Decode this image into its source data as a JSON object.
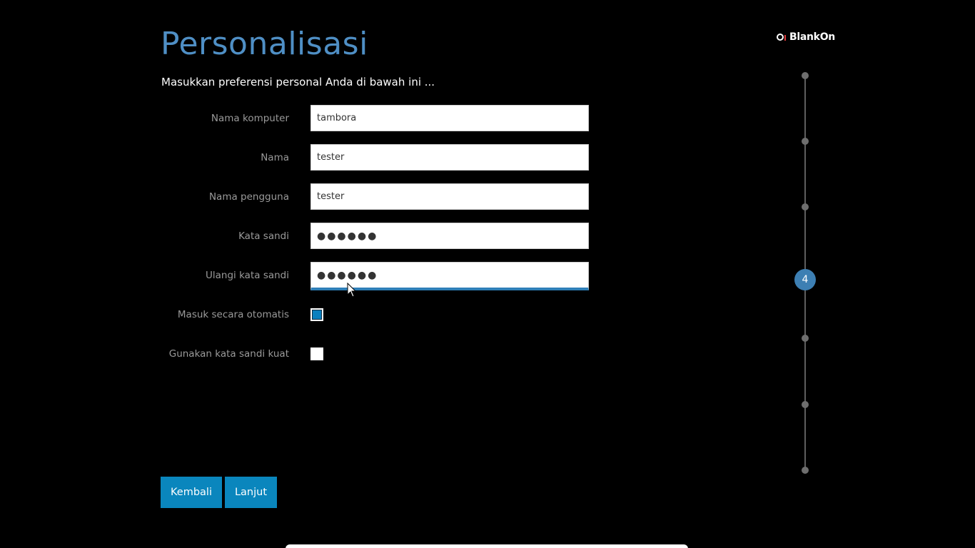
{
  "header": {
    "title": "Personalisasi",
    "subtitle": "Masukkan preferensi personal Anda di bawah ini ..."
  },
  "form": {
    "computer_name": {
      "label": "Nama komputer",
      "value": "tambora"
    },
    "full_name": {
      "label": "Nama",
      "value": "tester"
    },
    "username": {
      "label": "Nama pengguna",
      "value": "tester"
    },
    "password": {
      "label": "Kata sandi",
      "value": "●●●●●●"
    },
    "password_repeat": {
      "label": "Ulangi kata sandi",
      "value": "●●●●●●"
    },
    "auto_login": {
      "label": "Masuk secara otomatis",
      "checked": true
    },
    "strong_password": {
      "label": "Gunakan kata sandi kuat",
      "checked": false
    }
  },
  "buttons": {
    "back_label": "Kembali",
    "next_label": "Lanjut"
  },
  "logo": {
    "text": "BlankOn"
  },
  "stepper": {
    "current_step": "4",
    "total_steps": 7
  },
  "colors": {
    "accent": "#4f8fc5",
    "button": "#0a86bd",
    "background": "#000000"
  }
}
